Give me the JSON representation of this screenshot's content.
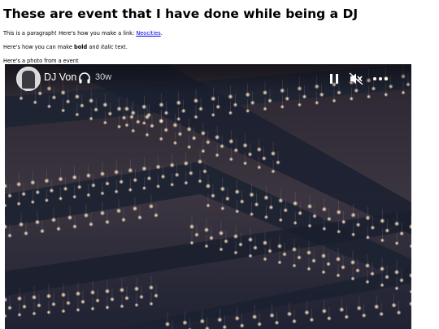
{
  "heading": "These are event that I have done while being a DJ",
  "paragraph1": {
    "text": "This is a paragraph! Here's how you make a link: ",
    "link": "Neocities",
    "end": "."
  },
  "paragraph2": {
    "prefix": "Here's how you can make ",
    "bold": "bold",
    "middle": " and ",
    "italic": "italic",
    "suffix": " text."
  },
  "paragraph3": "Here's a photo from a event",
  "story": {
    "author": "DJ Von",
    "time": "30w",
    "icons": [
      "headphones-icon",
      "pause-icon",
      "mute-icon",
      "more-icon"
    ]
  }
}
